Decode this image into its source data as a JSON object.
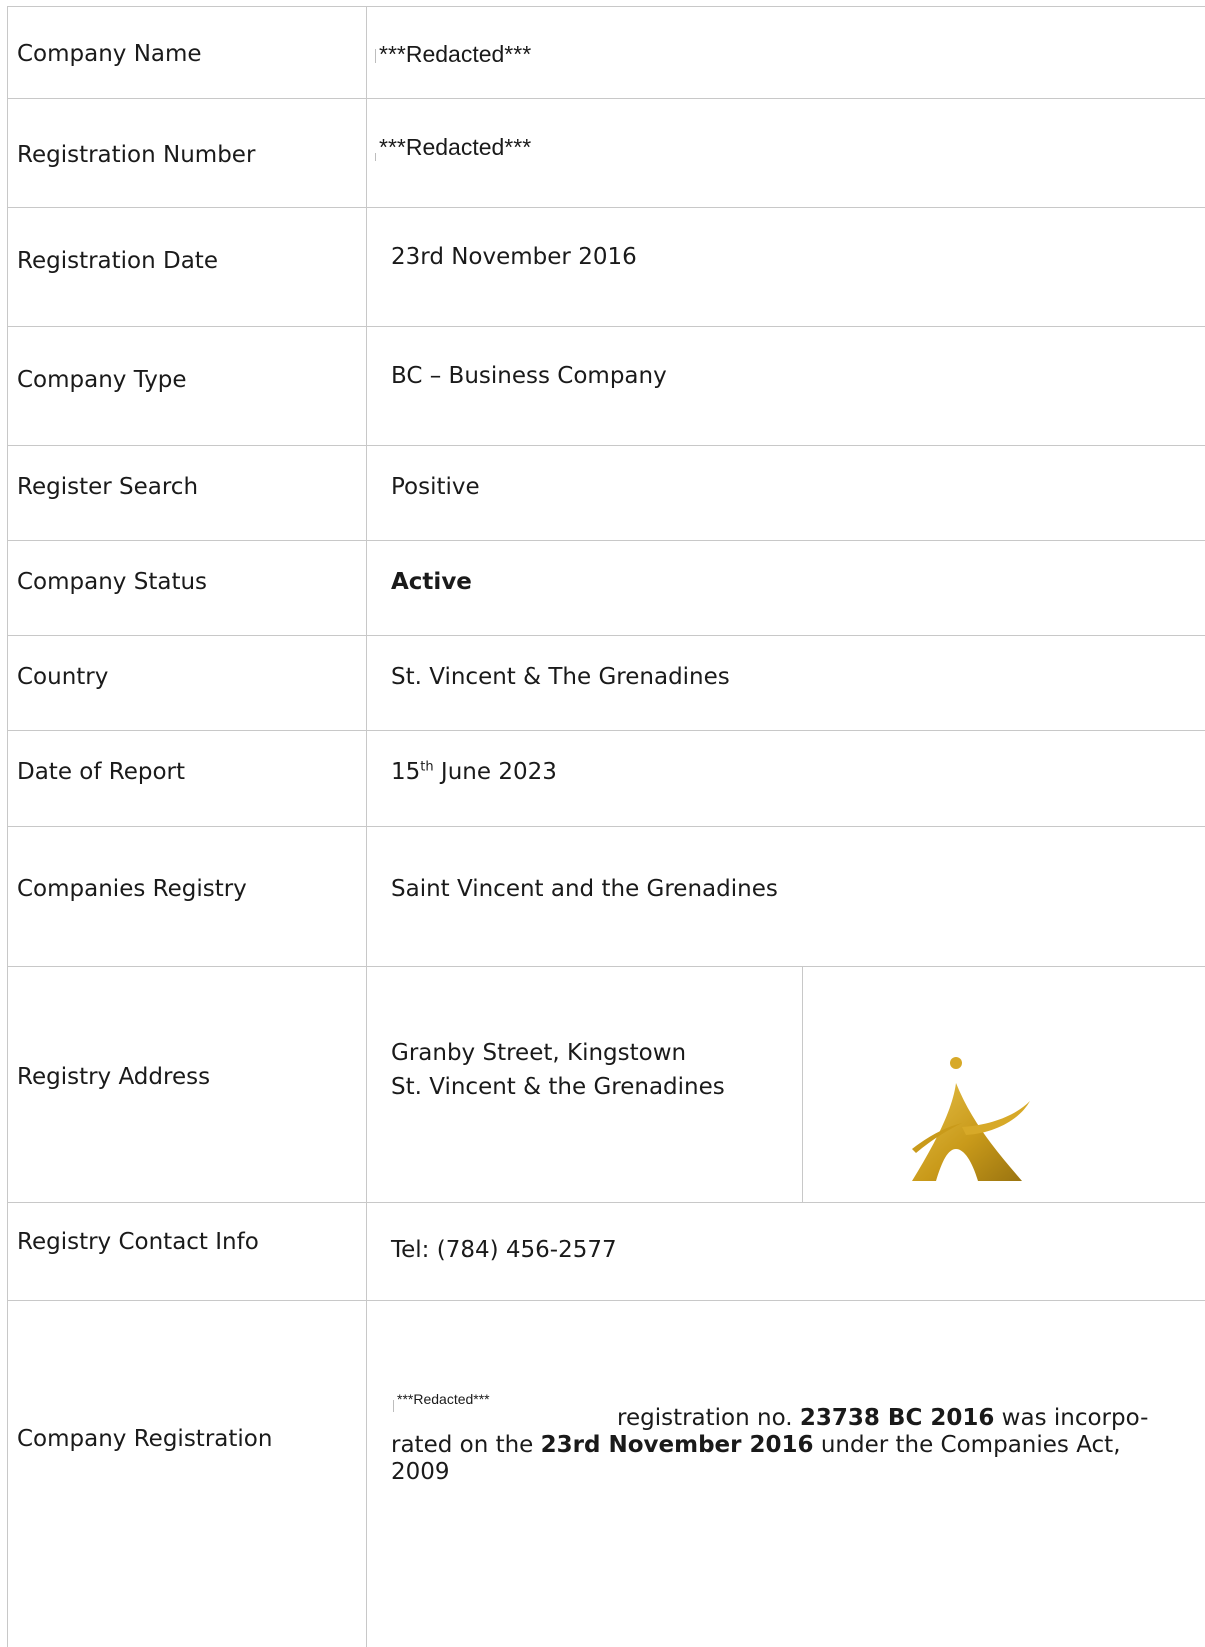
{
  "rows": {
    "company_name": {
      "label": "Company Name",
      "value": "***Redacted***"
    },
    "registration_number": {
      "label": "Registration Number",
      "value": "***Redacted***"
    },
    "registration_date": {
      "label": "Registration Date",
      "value": "23rd November 2016"
    },
    "company_type": {
      "label": "Company Type",
      "value": "BC – Business Company"
    },
    "register_search": {
      "label": "Register Search",
      "value": "Positive"
    },
    "company_status": {
      "label": "Company Status",
      "value": "Active"
    },
    "country": {
      "label": "Country",
      "value": "St. Vincent & The Grenadines"
    },
    "date_of_report": {
      "label": "Date of Report",
      "day": "15",
      "suffix": "th",
      "rest": " June 2023"
    },
    "companies_registry": {
      "label": "Companies Registry",
      "value": "Saint Vincent and the Grenadines"
    },
    "registry_address": {
      "label": "Registry Address",
      "line1": "Granby Street, Kingstown",
      "line2": "St. Vincent & the Grenadines"
    },
    "registry_contact": {
      "label": "Registry Contact Info",
      "value": "Tel: (784) 456-2577"
    },
    "company_registration": {
      "label": "Company Registration",
      "redacted": "***Redacted***",
      "t1": "registration no. ",
      "b1": "23738 BC 2016",
      "t2": " was incorpo-",
      "t3": "rated on the ",
      "b2": "23rd November 2016",
      "t4": " under the Companies Act,",
      "t5": "2009"
    }
  },
  "logo": {
    "icon": "registry-emblem-icon",
    "colors": {
      "gold": "#c99a1a",
      "gold_light": "#e6c04a",
      "gold_dark": "#9a7410"
    }
  }
}
